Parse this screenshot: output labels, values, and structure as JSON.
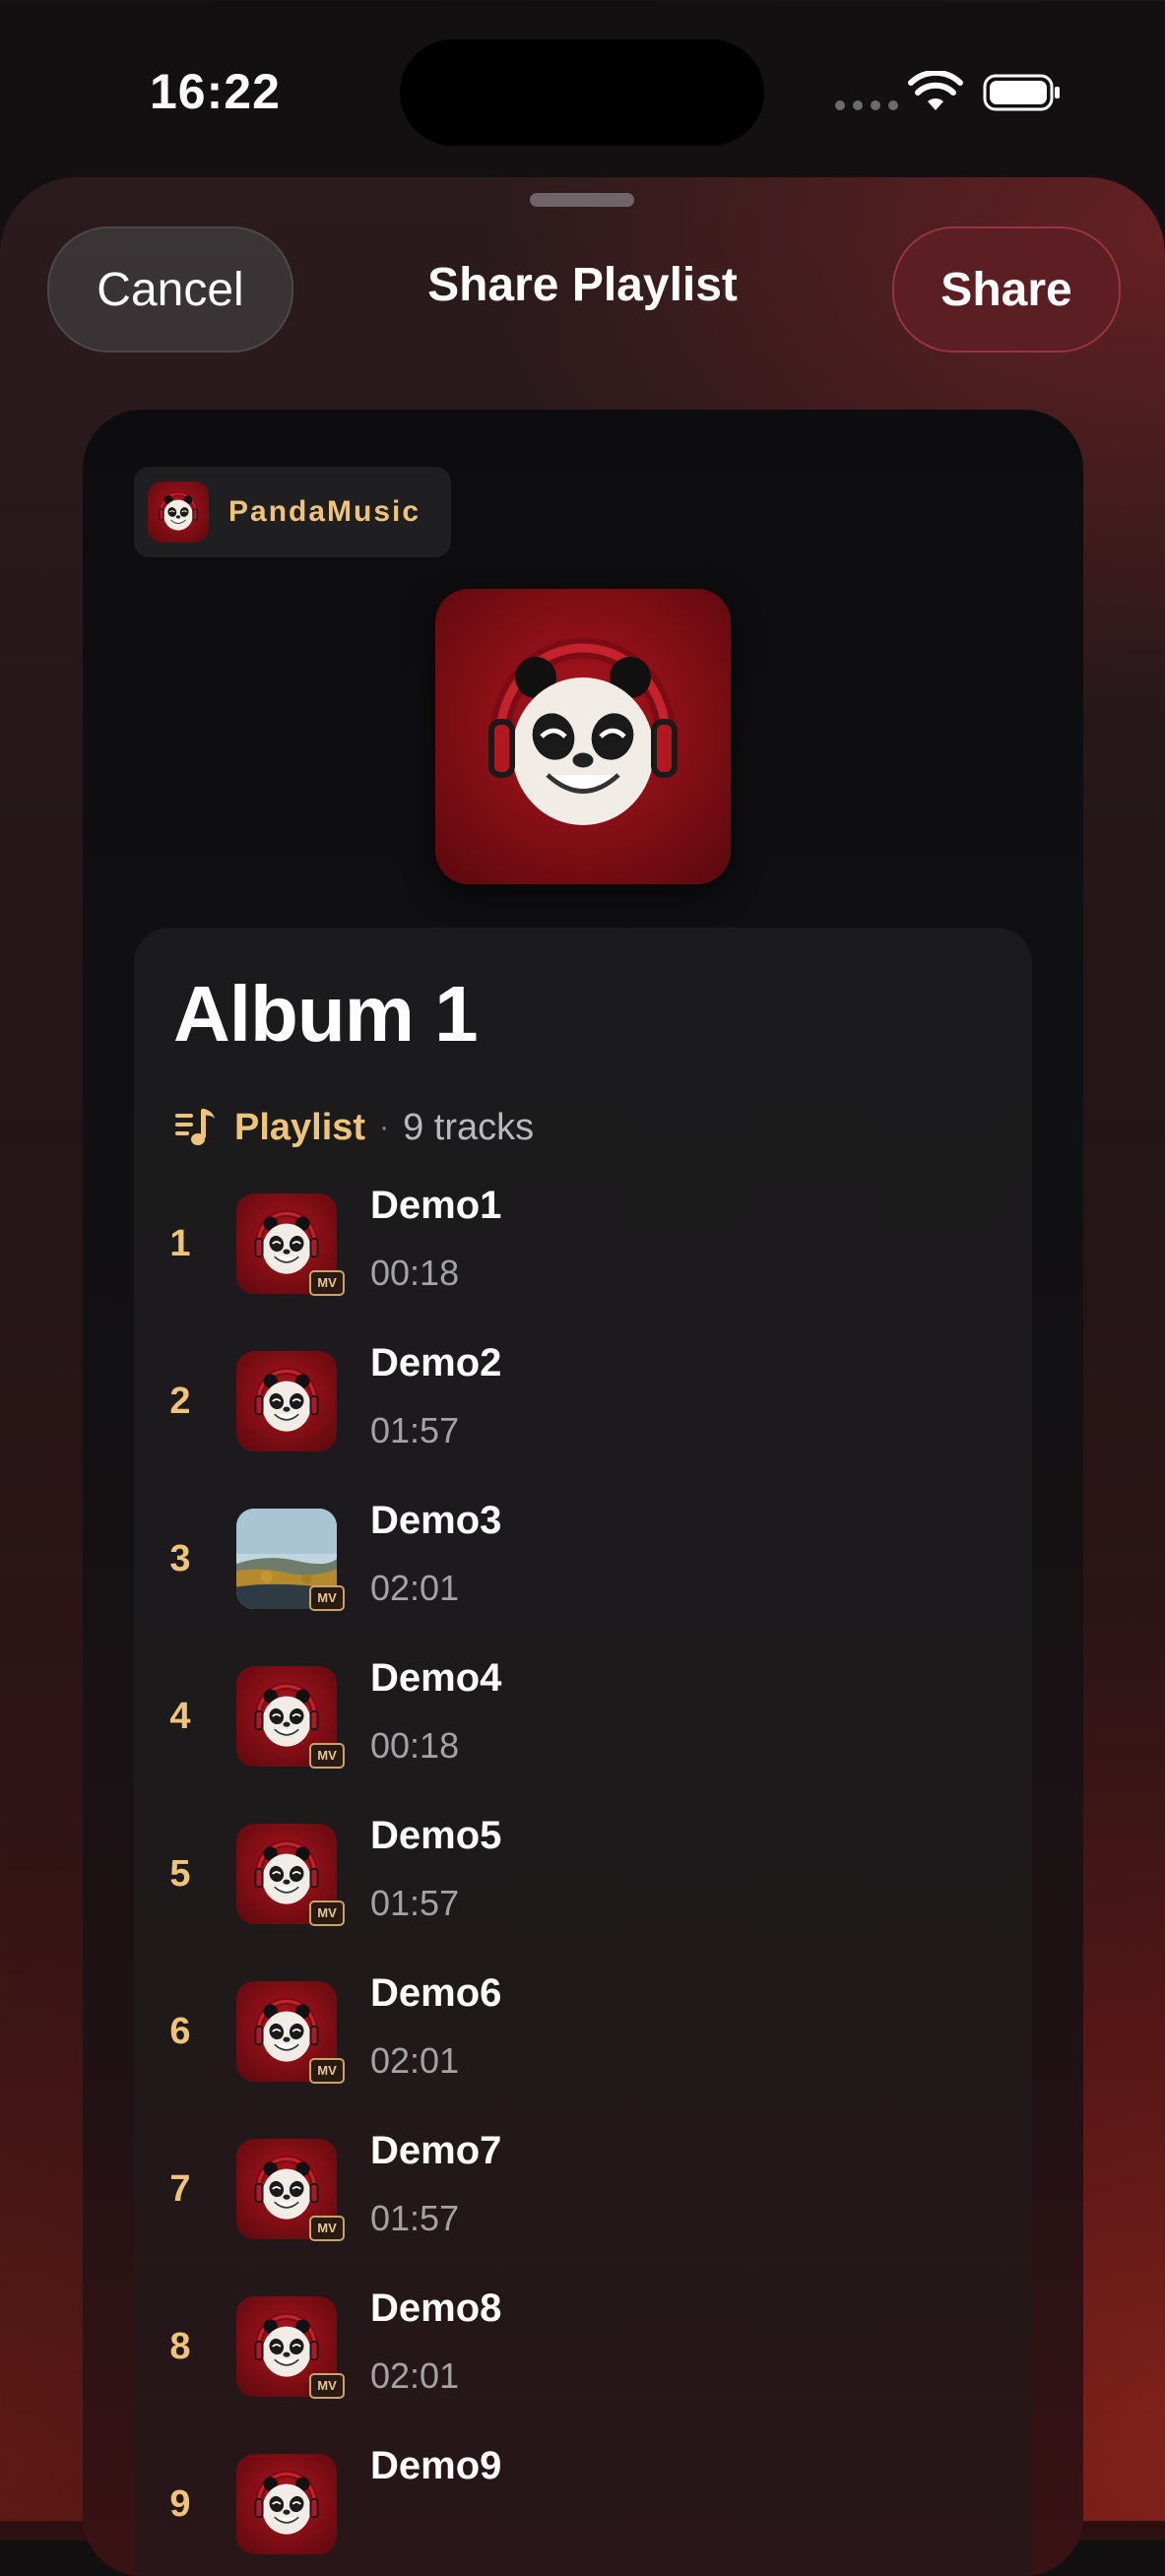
{
  "status_bar": {
    "time": "16:22"
  },
  "sheet": {
    "title": "Share Playlist",
    "cancel_label": "Cancel",
    "share_label": "Share"
  },
  "card": {
    "brand": "PandaMusic",
    "album_title": "Album 1",
    "type_label": "Playlist",
    "separator": "·",
    "track_count": "9 tracks",
    "tracks": [
      {
        "number": "1",
        "title": "Demo1",
        "duration": "00:18",
        "cover": "panda",
        "mv": "MV"
      },
      {
        "number": "2",
        "title": "Demo2",
        "duration": "01:57",
        "cover": "panda",
        "mv": ""
      },
      {
        "number": "3",
        "title": "Demo3",
        "duration": "02:01",
        "cover": "landscape",
        "mv": "MV"
      },
      {
        "number": "4",
        "title": "Demo4",
        "duration": "00:18",
        "cover": "panda",
        "mv": "MV"
      },
      {
        "number": "5",
        "title": "Demo5",
        "duration": "01:57",
        "cover": "panda",
        "mv": "MV"
      },
      {
        "number": "6",
        "title": "Demo6",
        "duration": "02:01",
        "cover": "panda",
        "mv": "MV"
      },
      {
        "number": "7",
        "title": "Demo7",
        "duration": "01:57",
        "cover": "panda",
        "mv": "MV"
      },
      {
        "number": "8",
        "title": "Demo8",
        "duration": "02:01",
        "cover": "panda",
        "mv": "MV"
      },
      {
        "number": "9",
        "title": "Demo9",
        "duration": "",
        "cover": "panda",
        "mv": ""
      }
    ]
  },
  "colors": {
    "accent_gold": "#f0c37a",
    "cover_red": "#8e1018"
  }
}
